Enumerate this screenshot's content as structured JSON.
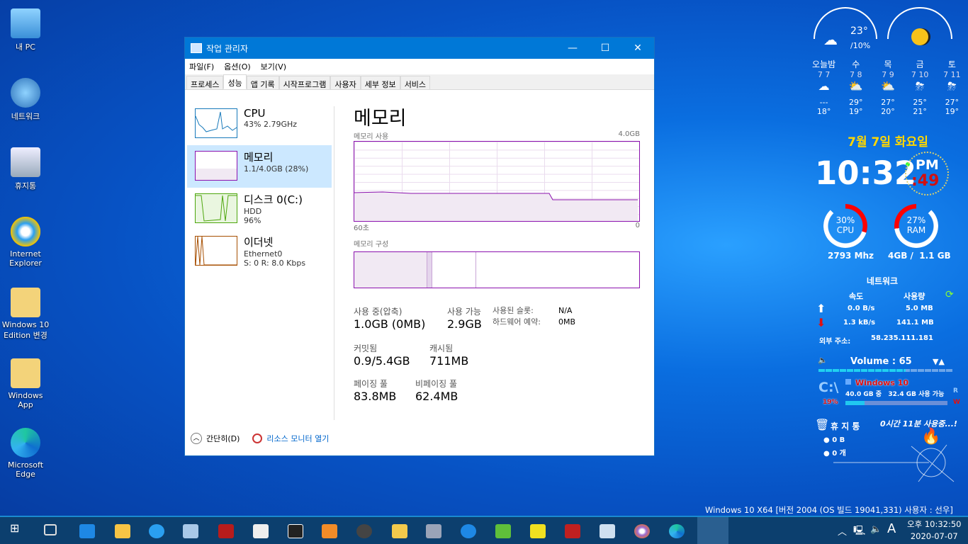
{
  "desktop": {
    "icons": [
      "내 PC",
      "네트워크",
      "휴지통",
      "Internet Explorer",
      "Windows 10 Edition 변경",
      "Windows App",
      "Microsoft Edge"
    ]
  },
  "window": {
    "title": "작업 관리자",
    "controls": {
      "minimize": "—",
      "maximize": "☐",
      "close": "✕"
    },
    "menu": [
      "파일(F)",
      "옵션(O)",
      "보기(V)"
    ],
    "tabs": [
      "프로세스",
      "성능",
      "앱 기록",
      "시작프로그램",
      "사용자",
      "세부 정보",
      "서비스"
    ],
    "active_tab": "성능",
    "side": [
      {
        "title": "CPU",
        "sub1": "43% 2.79GHz",
        "sub2": ""
      },
      {
        "title": "메모리",
        "sub1": "1.1/4.0GB (28%)",
        "sub2": ""
      },
      {
        "title": "디스크 0(C:)",
        "sub1": "HDD",
        "sub2": "96%"
      },
      {
        "title": "이더넷",
        "sub1": "Ethernet0",
        "sub2": "S: 0 R: 8.0 Kbps"
      }
    ],
    "main": {
      "heading": "메모리",
      "usage_label": "메모리 사용",
      "usage_max": "4.0GB",
      "axis_left": "60초",
      "axis_right": "0",
      "composition_label": "메모리 구성",
      "stats": {
        "in_use_label": "사용 중(압축)",
        "in_use": "1.0GB (0MB)",
        "available_label": "사용 가능",
        "available": "2.9GB",
        "slots_label": "사용된 슬롯:",
        "slots": "N/A",
        "hw_reserved_label": "하드웨어 예약:",
        "hw_reserved": "0MB",
        "committed_label": "커밋됨",
        "committed": "0.9/5.4GB",
        "cached_label": "캐시됨",
        "cached": "711MB",
        "paged_label": "페이징 풀",
        "paged": "83.8MB",
        "nonpaged_label": "비페이징 풀",
        "nonpaged": "62.4MB"
      }
    },
    "footer": {
      "fewer": "간단히(D)",
      "resmon": "리소스 모니터 열기"
    }
  },
  "gadget": {
    "weather_now": {
      "temp": "23°",
      "rain": "10%"
    },
    "forecast": [
      {
        "day": "오늘밤",
        "date": "7 7",
        "hi": "---",
        "lo": "18°"
      },
      {
        "day": "수",
        "date": "7 8",
        "hi": "29°",
        "lo": "19°"
      },
      {
        "day": "목",
        "date": "7 9",
        "hi": "27°",
        "lo": "20°"
      },
      {
        "day": "금",
        "date": "7 10",
        "hi": "25°",
        "lo": "21°"
      },
      {
        "day": "토",
        "date": "7 11",
        "hi": "27°",
        "lo": "19°"
      }
    ],
    "date": "7월 7일 화요일",
    "time": "10:32",
    "ampm": "PM",
    "seconds": ":49",
    "cpu": {
      "pct": "30%",
      "label": "CPU",
      "freq": "2793 Mhz",
      "value": 30
    },
    "ram": {
      "pct": "27%",
      "label": "RAM",
      "size": "4GB /  1.1 GB",
      "value": 27
    },
    "net": {
      "title": "네트워크",
      "speed": "속도",
      "usage": "사용량",
      "up_speed": "0.0 B/s",
      "up_usage": "5.0 MB",
      "down_speed": "1.3 kB/s",
      "down_usage": "141.1 MB",
      "ext_label": "외부 주소:",
      "ext_ip": "58.235.111.181"
    },
    "volume": {
      "label": "Volume : 65",
      "value": 65
    },
    "drive": {
      "letter": "C:\\",
      "name": "Windows 10",
      "info": "40.0 GB 중   32.4 GB 사용 가능",
      "pct": "19%",
      "value": 19,
      "r": "R",
      "w": "W"
    },
    "recycle": {
      "label": "휴 지 통",
      "uptime": "0시간 11분 사용중...!",
      "size": "0 B",
      "count": "0 개"
    },
    "colors": {
      "accent": "#ffd700",
      "alert": "#e01010"
    }
  },
  "os_banner": "Windows 10 X64 [버전 2004 (OS 빌드 19041,331) 사용자 : 선우]",
  "taskbar": {
    "time": "오후 10:32:50",
    "date": "2020-07-07",
    "ime": "A"
  }
}
